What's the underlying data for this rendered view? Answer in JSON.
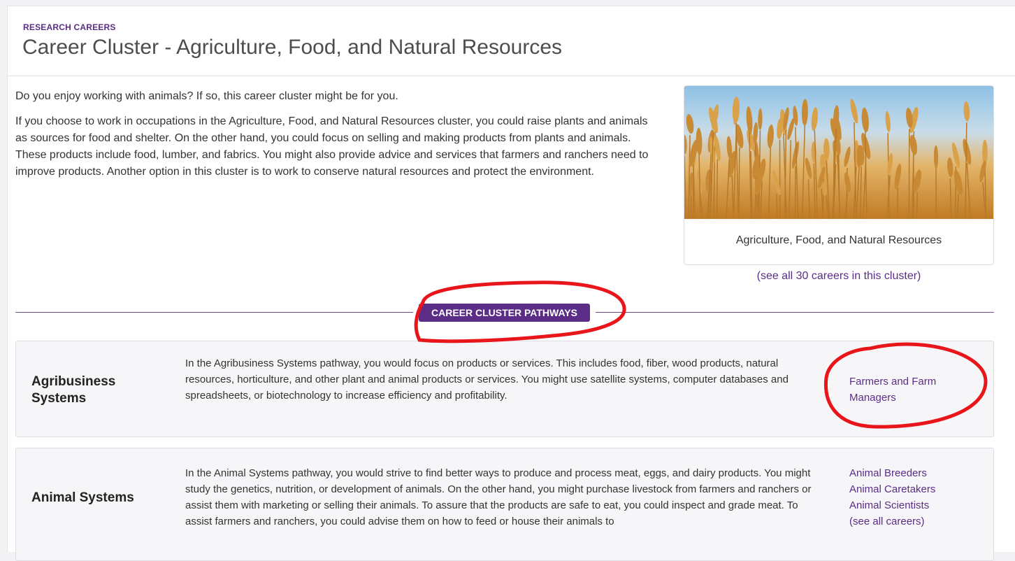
{
  "header": {
    "eyebrow": "RESEARCH CAREERS",
    "title": "Career Cluster - Agriculture, Food, and Natural Resources"
  },
  "intro": {
    "lead": "Do you enjoy working with animals?  If so, this career cluster might be for you.",
    "body": "If you choose to work in occupations in the Agriculture, Food, and Natural Resources cluster, you could raise plants and animals as sources for food and shelter. On the other hand, you could focus on selling and making products from plants and animals. These products include food, lumber, and fabrics. You might also provide advice and services that farmers and ranchers need to improve products. Another option in this cluster is to work to conserve natural resources and protect the environment."
  },
  "feature": {
    "caption": "Agriculture, Food, and Natural Resources",
    "see_all": "(see all 30 careers in this cluster)"
  },
  "pathways_badge": "CAREER CLUSTER PATHWAYS",
  "pathways": [
    {
      "name": "Agribusiness Systems",
      "description": "In the Agribusiness Systems pathway, you would focus on products or services. This includes food, fiber, wood products, natural resources, horticulture, and other plant and animal products or services. You might use satellite systems, computer databases and spreadsheets, or biotechnology to increase efficiency and profitability.",
      "links": [
        "Farmers and Farm Managers"
      ]
    },
    {
      "name": "Animal Systems",
      "description": "In the Animal Systems pathway, you would strive to find better ways to produce and process meat, eggs, and dairy products. You might study the genetics, nutrition, or development of animals. On the other hand, you might purchase livestock from farmers and ranchers or assist them with marketing or selling their animals. To assure that the products are safe to eat, you could inspect and grade meat. To assist farmers and ranchers, you could advise them on how to feed or house their animals to",
      "links": [
        "Animal Breeders",
        "Animal Caretakers",
        "Animal Scientists",
        "(see all careers)"
      ]
    }
  ],
  "colors": {
    "accent": "#5b2d86",
    "annotation": "#e8161b",
    "panel": "#f6f6f8"
  }
}
